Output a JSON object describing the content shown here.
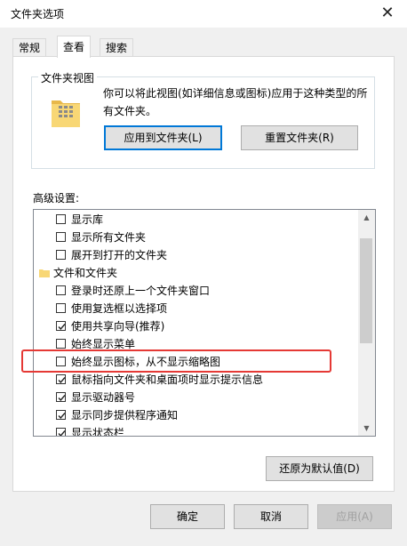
{
  "window": {
    "title": "文件夹选项",
    "close_glyph": "✕"
  },
  "tabs": [
    {
      "label": "常规"
    },
    {
      "label": "查看"
    },
    {
      "label": "搜索"
    }
  ],
  "folder_view": {
    "group_label": "文件夹视图",
    "description": "你可以将此视图(如详细信息或图标)应用于这种类型的所有文件夹。",
    "apply_button": "应用到文件夹(L)",
    "reset_button": "重置文件夹(R)",
    "icon": "folder-icon"
  },
  "advanced": {
    "label": "高级设置:",
    "items": [
      {
        "label": "显示库",
        "checked": false,
        "type": "checkbox"
      },
      {
        "label": "显示所有文件夹",
        "checked": false,
        "type": "checkbox"
      },
      {
        "label": "展开到打开的文件夹",
        "checked": false,
        "type": "checkbox"
      },
      {
        "label": "文件和文件夹",
        "type": "category"
      },
      {
        "label": "登录时还原上一个文件夹窗口",
        "checked": false,
        "type": "checkbox"
      },
      {
        "label": "使用复选框以选择项",
        "checked": false,
        "type": "checkbox"
      },
      {
        "label": "使用共享向导(推荐)",
        "checked": true,
        "type": "checkbox"
      },
      {
        "label": "始终显示菜单",
        "checked": false,
        "type": "checkbox"
      },
      {
        "label": "始终显示图标，从不显示缩略图",
        "checked": false,
        "type": "checkbox"
      },
      {
        "label": "鼠标指向文件夹和桌面项时显示提示信息",
        "checked": true,
        "type": "checkbox"
      },
      {
        "label": "显示驱动器号",
        "checked": true,
        "type": "checkbox"
      },
      {
        "label": "显示同步提供程序通知",
        "checked": true,
        "type": "checkbox"
      },
      {
        "label": "显示状态栏",
        "checked": true,
        "type": "checkbox"
      }
    ],
    "restore_button": "还原为默认值(D)",
    "scroll_up": "▲",
    "scroll_down": "▼"
  },
  "footer": {
    "ok": "确定",
    "cancel": "取消",
    "apply": "应用(A)"
  },
  "colors": {
    "highlight": "#e53935",
    "focus": "#0078d7",
    "folder": "#f8d775"
  }
}
